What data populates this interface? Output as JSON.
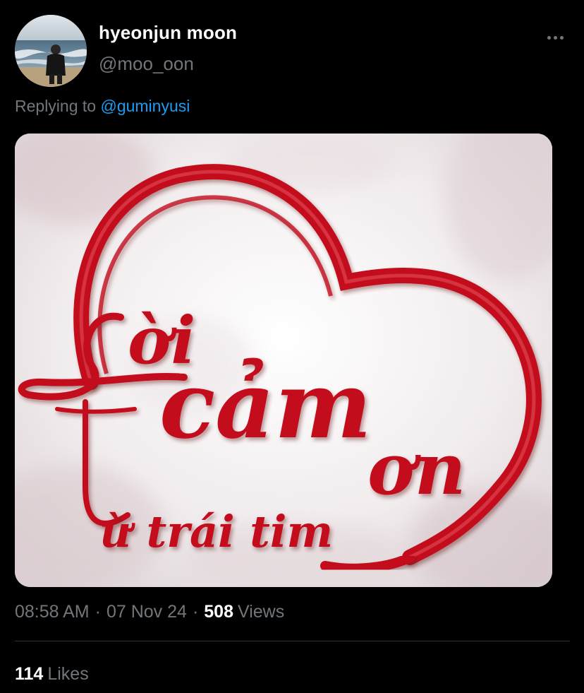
{
  "tweet": {
    "author": {
      "display_name": "hyeonjun moon",
      "handle": "@moo_oon"
    },
    "reply": {
      "prefix": "Replying to",
      "mention": "@guminyusi"
    },
    "media": {
      "image_text": {
        "line1": "ời",
        "line2": "cảm",
        "line3": "ơn",
        "line4": "ừ trái tim",
        "initial": "L"
      },
      "accent_color": "#c3111f"
    },
    "meta": {
      "time": "08:58 AM",
      "separator": "·",
      "date": "07 Nov 24",
      "views_count": "508",
      "views_label": "Views"
    },
    "stats": {
      "likes_count": "114",
      "likes_label": "Likes"
    }
  },
  "colors": {
    "background": "#000000",
    "secondary_text": "#71767b",
    "link": "#1d9bf0",
    "divider": "#2f3336"
  },
  "icons": {
    "more": "more-horizontal-icon"
  }
}
